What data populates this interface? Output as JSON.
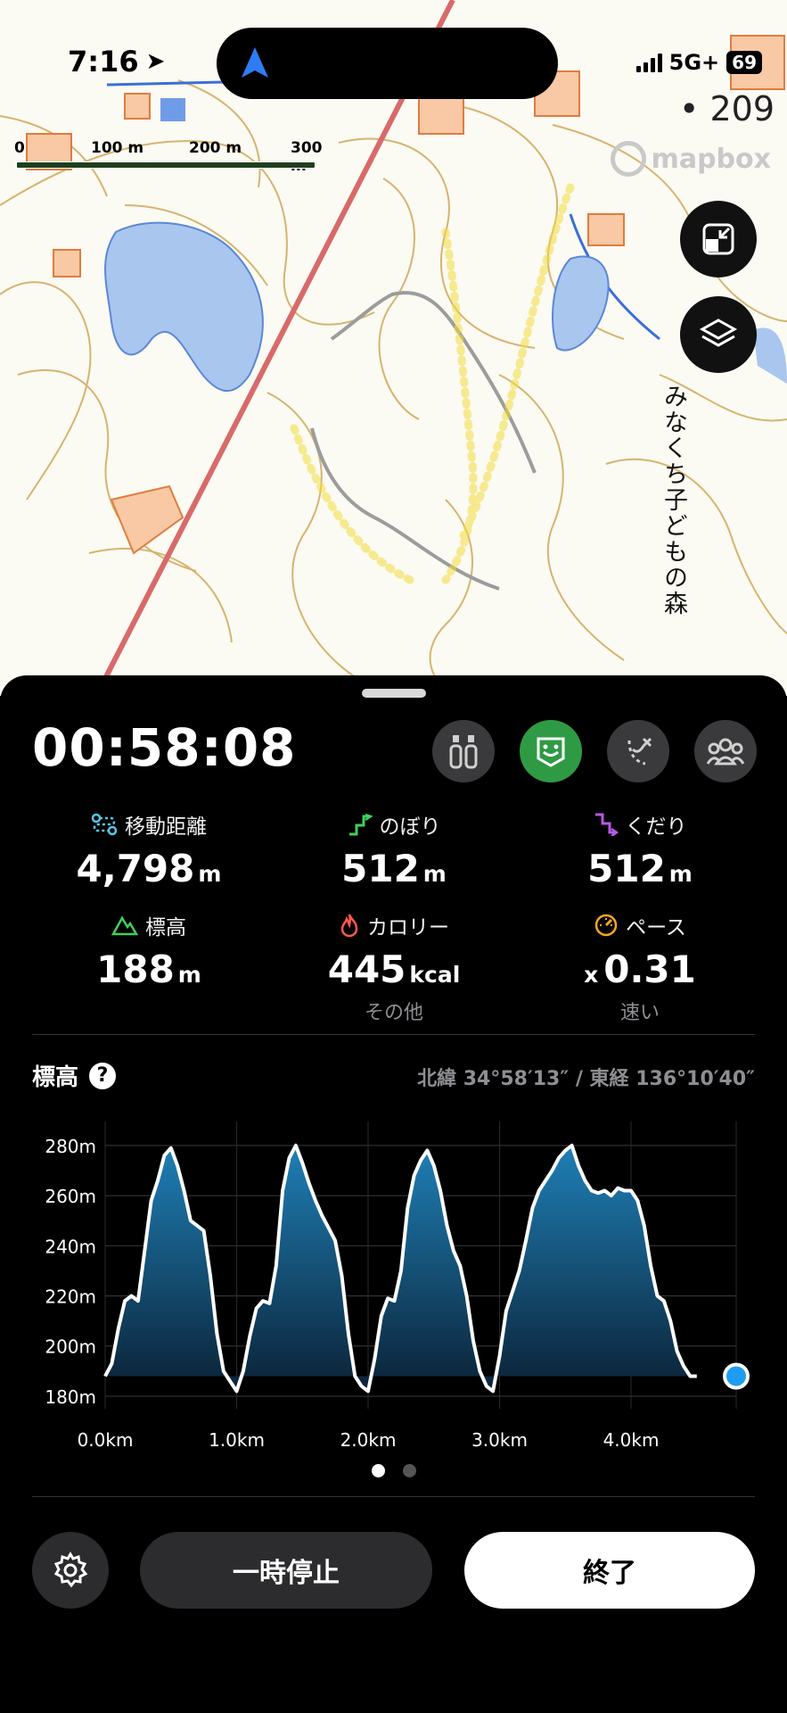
{
  "status_bar": {
    "time": "7:16",
    "network": "5G+",
    "battery": "69"
  },
  "map": {
    "scale_labels": [
      "0",
      "100 m",
      "200 m",
      "300 m"
    ],
    "attribution": "mapbox",
    "number_label": "209",
    "place_label": "みなくち子どもの森",
    "layer_buttons": [
      "collapse-icon",
      "layers-icon"
    ]
  },
  "panel": {
    "elapsed_time": "00:58:08",
    "stats": [
      {
        "label": "移動距離",
        "value": "4,798",
        "unit": "m",
        "icon": "route-icon",
        "color": "#59c6e8"
      },
      {
        "label": "のぼり",
        "value": "512",
        "unit": "m",
        "icon": "ascent-icon",
        "color": "#3fcf5e"
      },
      {
        "label": "くだり",
        "value": "512",
        "unit": "m",
        "icon": "descent-icon",
        "color": "#b75ae6"
      },
      {
        "label": "標高",
        "value": "188",
        "unit": "m",
        "icon": "mountain-icon",
        "color": "#3fcf5e"
      },
      {
        "label": "カロリー",
        "value": "445",
        "unit": "kcal",
        "icon": "flame-icon",
        "color": "#ff5a4a",
        "sub": "その他"
      },
      {
        "label": "ペース",
        "value": "0.31",
        "prefix": "x",
        "icon": "speedometer-icon",
        "color": "#f5a623",
        "sub": "速い"
      }
    ],
    "elevation": {
      "title": "標高",
      "help": "?",
      "coordinates": "北緯 34°58′13″ / 東経 136°10′40″"
    },
    "pager": {
      "pages": 2,
      "current": 1
    },
    "buttons": {
      "pause": "一時停止",
      "end": "終了"
    }
  },
  "chart_data": {
    "type": "area",
    "title": "標高",
    "xlabel": "",
    "ylabel": "",
    "x_tick_labels": [
      "0.0km",
      "1.0km",
      "2.0km",
      "3.0km",
      "4.0km"
    ],
    "y_tick_labels": [
      "180m",
      "200m",
      "220m",
      "240m",
      "260m",
      "280m"
    ],
    "xlim": [
      0,
      4.8
    ],
    "ylim": [
      175,
      286
    ],
    "grid": true,
    "x": [
      0.0,
      0.05,
      0.1,
      0.15,
      0.2,
      0.25,
      0.3,
      0.35,
      0.4,
      0.45,
      0.5,
      0.55,
      0.6,
      0.65,
      0.7,
      0.75,
      0.8,
      0.85,
      0.9,
      0.95,
      1.0,
      1.05,
      1.1,
      1.15,
      1.2,
      1.25,
      1.3,
      1.35,
      1.4,
      1.45,
      1.5,
      1.55,
      1.6,
      1.65,
      1.7,
      1.75,
      1.8,
      1.85,
      1.9,
      1.95,
      2.0,
      2.05,
      2.1,
      2.15,
      2.2,
      2.25,
      2.3,
      2.35,
      2.4,
      2.45,
      2.5,
      2.55,
      2.6,
      2.65,
      2.7,
      2.75,
      2.8,
      2.85,
      2.9,
      2.95,
      3.0,
      3.05,
      3.1,
      3.15,
      3.2,
      3.25,
      3.3,
      3.35,
      3.4,
      3.45,
      3.5,
      3.55,
      3.6,
      3.65,
      3.7,
      3.75,
      3.8,
      3.85,
      3.9,
      3.95,
      4.0,
      4.05,
      4.1,
      4.15,
      4.2,
      4.25,
      4.3,
      4.35,
      4.4,
      4.45,
      4.5,
      4.55,
      4.6,
      4.65,
      4.7,
      4.75,
      4.8
    ],
    "series": [
      {
        "values": [
          188,
          193,
          207,
          218,
          220,
          218,
          238,
          258,
          266,
          276,
          279,
          272,
          262,
          250,
          248,
          246,
          228,
          205,
          190,
          186,
          182,
          190,
          204,
          215,
          218,
          217,
          232,
          262,
          275,
          280,
          273,
          265,
          258,
          252,
          247,
          242,
          228,
          205,
          188,
          184,
          182,
          195,
          212,
          219,
          218,
          230,
          255,
          268,
          274,
          278,
          272,
          262,
          248,
          238,
          232,
          220,
          202,
          190,
          184,
          182,
          196,
          214,
          222,
          230,
          242,
          255,
          262,
          266,
          270,
          275,
          278,
          280,
          272,
          266,
          262,
          261,
          262,
          260,
          263,
          262,
          262,
          258,
          248,
          232,
          220,
          218,
          210,
          198,
          192,
          188,
          188
        ]
      }
    ],
    "current_point": {
      "x": 4.8,
      "y": 188
    }
  }
}
